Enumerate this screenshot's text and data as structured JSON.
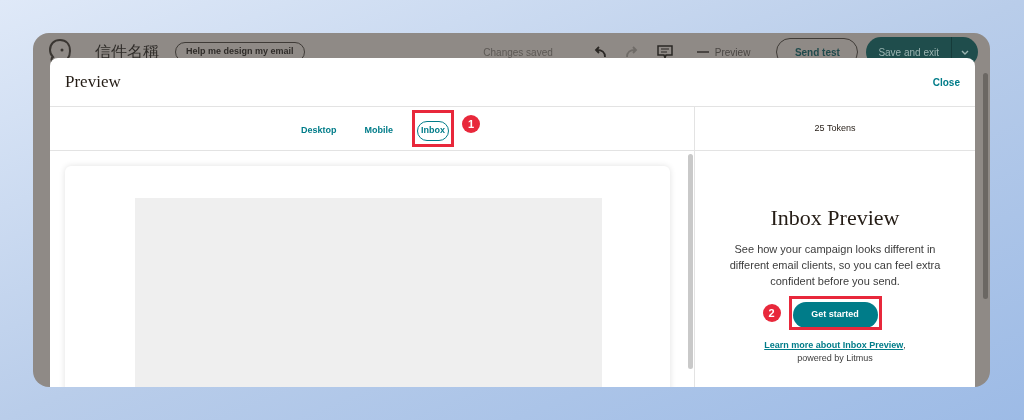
{
  "app_bar": {
    "title": "信件名稱",
    "assist_button": "Help me design my email",
    "save_status": "Changes saved",
    "redo_disabled": true,
    "preview_toggle": {
      "label": "Preview",
      "disabled": true
    },
    "send_test": "Send test",
    "save_exit": "Save and exit"
  },
  "modal": {
    "title": "Preview",
    "close": "Close",
    "tabs": [
      {
        "label": "Desktop",
        "selected": false
      },
      {
        "label": "Mobile",
        "selected": false
      },
      {
        "label": "Inbox",
        "selected": true,
        "annotation": "1"
      }
    ],
    "tokens": "25 Tokens",
    "panel": {
      "heading": "Inbox Preview",
      "body": "See how your campaign looks different in different email clients, so you can feel extra confident before you send.",
      "button": "Get started",
      "button_annotation": "2",
      "link": "Learn more about Inbox Preview",
      "link_suffix": ", powered by Litmus"
    }
  }
}
